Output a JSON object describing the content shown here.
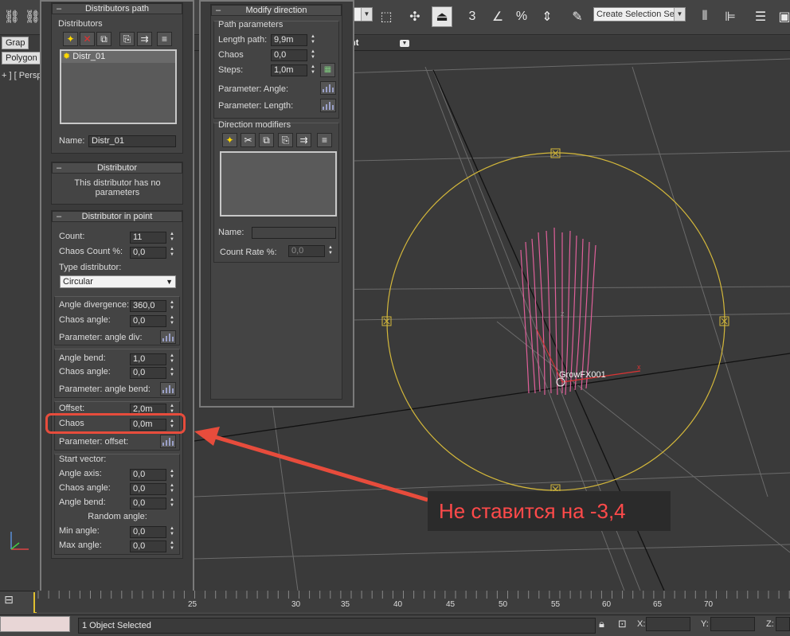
{
  "toolbar": {
    "selection_set_placeholder": "Create Selection Se"
  },
  "left_strip": {
    "tab_graphite": "Grap",
    "tab_polygon": "Polygon",
    "viewport_label": "+ ] [ Persp"
  },
  "viewport_subbar": {
    "word": "nt"
  },
  "distributors_path": {
    "title": "Distributors path",
    "distributors_group": "Distributors",
    "list_items": [
      "Distr_01"
    ],
    "name_label": "Name:",
    "name_value": "Distr_01"
  },
  "distributor": {
    "title": "Distributor",
    "message": "This distributor has no parameters"
  },
  "distributor_in_point": {
    "title": "Distributor in point",
    "count_label": "Count:",
    "count_value": "11",
    "chaos_count_label": "Chaos Count %:",
    "chaos_count_value": "0,0",
    "type_label": "Type distributor:",
    "type_value": "Circular",
    "angle_div_label": "Angle divergence:",
    "angle_div_value": "360,0",
    "chaos_angle_label": "Chaos angle:",
    "chaos_angle_value": "0,0",
    "param_angle_div_label": "Parameter: angle div:",
    "angle_bend_label": "Angle bend:",
    "angle_bend_value": "1,0",
    "chaos_angle2_label": "Chaos angle:",
    "chaos_angle2_value": "0,0",
    "param_angle_bend_label": "Parameter: angle bend:",
    "offset_label": "Offset:",
    "offset_value": "2,0m",
    "chaos_label": "Chaos",
    "chaos_value": "0,0m",
    "param_offset_label": "Parameter: offset:",
    "start_vector_label": "Start vector:",
    "angle_axis_label": "Angle axis:",
    "angle_axis_value": "0,0",
    "sv_chaos_angle_label": "Chaos angle:",
    "sv_chaos_angle_value": "0,0",
    "sv_angle_bend_label": "Angle bend:",
    "sv_angle_bend_value": "0,0",
    "random_angle_label": "Random angle:",
    "min_angle_label": "Min angle:",
    "min_angle_value": "0,0",
    "max_angle_label": "Max angle:",
    "max_angle_value": "0,0"
  },
  "modify_direction": {
    "title": "Modify direction",
    "path_params_group": "Path parameters",
    "length_path_label": "Length path:",
    "length_path_value": "9,9m",
    "chaos_label": "Chaos",
    "chaos_value": "0,0",
    "steps_label": "Steps:",
    "steps_value": "1,0m",
    "param_angle_label": "Parameter: Angle:",
    "param_length_label": "Parameter: Length:",
    "dir_modifiers_group": "Direction modifiers",
    "name_label": "Name:",
    "name_value": "",
    "count_rate_label": "Count Rate %:",
    "count_rate_value": "0,0"
  },
  "scene": {
    "object_label": "GrowFX001",
    "axis_x": "x",
    "axis_z": "z"
  },
  "callout": {
    "text": "Не ставится на -3,4"
  },
  "timeline": {
    "ticks": [
      "25",
      "25",
      "30",
      "35",
      "40",
      "45",
      "50",
      "55",
      "60",
      "65",
      "70"
    ]
  },
  "status": {
    "text": "1 Object Selected",
    "x_label": "X:",
    "y_label": "Y:",
    "z_label": "Z:"
  },
  "colors": {
    "accent_red": "#e74c3c",
    "callout_text": "#ff4a4a",
    "circle": "#d4b83a",
    "object": "#e0609a"
  }
}
